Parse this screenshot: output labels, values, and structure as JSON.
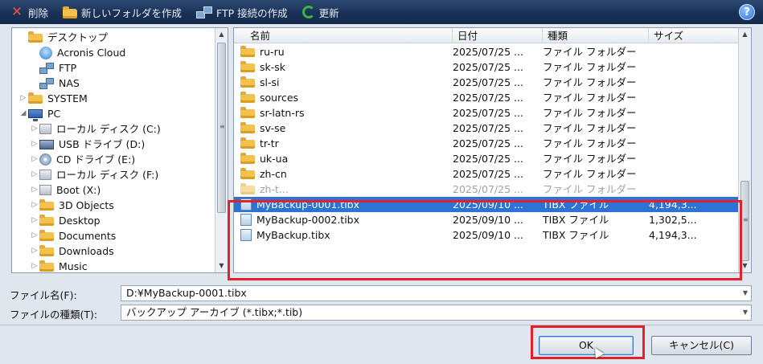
{
  "toolbar": {
    "delete_label": "削除",
    "new_folder_label": "新しいフォルダを作成",
    "ftp_label": "FTP 接続の作成",
    "refresh_label": "更新",
    "help_label": "?"
  },
  "tree": {
    "items": [
      {
        "label": "デスクトップ",
        "icon": "folder-icon",
        "expander": ""
      },
      {
        "label": "Acronis Cloud",
        "icon": "cloud-icon",
        "expander": ""
      },
      {
        "label": "FTP",
        "icon": "network-icon",
        "expander": ""
      },
      {
        "label": "NAS",
        "icon": "network-icon",
        "expander": ""
      },
      {
        "label": "SYSTEM",
        "icon": "folder-icon",
        "expander": "▷"
      },
      {
        "label": "PC",
        "icon": "computer-icon",
        "expander": "◢"
      },
      {
        "label": "ローカル ディスク (C:)",
        "icon": "disk-icon",
        "expander": "▷"
      },
      {
        "label": "USB ドライブ (D:)",
        "icon": "usb-drive-icon",
        "expander": "▷"
      },
      {
        "label": "CD ドライブ (E:)",
        "icon": "cd-drive-icon",
        "expander": "▷"
      },
      {
        "label": "ローカル ディスク (F:)",
        "icon": "disk-icon",
        "expander": "▷"
      },
      {
        "label": "Boot (X:)",
        "icon": "disk-icon",
        "expander": "▷"
      },
      {
        "label": "3D Objects",
        "icon": "folder-icon",
        "expander": "▷"
      },
      {
        "label": "Desktop",
        "icon": "folder-icon",
        "expander": "▷"
      },
      {
        "label": "Documents",
        "icon": "folder-icon",
        "expander": "▷"
      },
      {
        "label": "Downloads",
        "icon": "folder-icon",
        "expander": "▷"
      },
      {
        "label": "Music",
        "icon": "folder-icon",
        "expander": "▷"
      }
    ]
  },
  "list": {
    "columns": [
      "名前",
      "日付",
      "種類",
      "サイズ"
    ],
    "rows": [
      {
        "name": "ru-ru",
        "date": "2025/07/25 ...",
        "type": "ファイル フォルダー",
        "size": "",
        "kind": "folder"
      },
      {
        "name": "sk-sk",
        "date": "2025/07/25 ...",
        "type": "ファイル フォルダー",
        "size": "",
        "kind": "folder"
      },
      {
        "name": "sl-si",
        "date": "2025/07/25 ...",
        "type": "ファイル フォルダー",
        "size": "",
        "kind": "folder"
      },
      {
        "name": "sources",
        "date": "2025/07/25 ...",
        "type": "ファイル フォルダー",
        "size": "",
        "kind": "folder"
      },
      {
        "name": "sr-latn-rs",
        "date": "2025/07/25 ...",
        "type": "ファイル フォルダー",
        "size": "",
        "kind": "folder"
      },
      {
        "name": "sv-se",
        "date": "2025/07/25 ...",
        "type": "ファイル フォルダー",
        "size": "",
        "kind": "folder"
      },
      {
        "name": "tr-tr",
        "date": "2025/07/25 ...",
        "type": "ファイル フォルダー",
        "size": "",
        "kind": "folder"
      },
      {
        "name": "uk-ua",
        "date": "2025/07/25 ...",
        "type": "ファイル フォルダー",
        "size": "",
        "kind": "folder"
      },
      {
        "name": "zh-cn",
        "date": "2025/07/25 ...",
        "type": "ファイル フォルダー",
        "size": "",
        "kind": "folder"
      },
      {
        "name": "zh-t...",
        "date": "2025/07/25 ...",
        "type": "ファイル フォルダー",
        "size": "",
        "kind": "folder"
      },
      {
        "name": "MyBackup-0001.tibx",
        "date": "2025/09/10 ...",
        "type": "TIBX ファイル",
        "size": "4,194,3...",
        "kind": "file"
      },
      {
        "name": "MyBackup-0002.tibx",
        "date": "2025/09/10 ...",
        "type": "TIBX ファイル",
        "size": "1,302,5...",
        "kind": "file"
      },
      {
        "name": "MyBackup.tibx",
        "date": "2025/09/10 ...",
        "type": "TIBX ファイル",
        "size": "4,194,3...",
        "kind": "file"
      }
    ],
    "selected_index": 10
  },
  "fields": {
    "filename_label": "ファイル名(F):",
    "filename_value": "D:¥MyBackup-0001.tibx",
    "filetype_label": "ファイルの種類(T):",
    "filetype_value": "バックアップ アーカイブ (*.tibx;*.tib)"
  },
  "buttons": {
    "ok_label": "OK",
    "cancel_label": "キャンセル(C)"
  },
  "colors": {
    "selection": "#2d72d5",
    "highlight_box": "#e5202a",
    "toolbar": "#1a3157"
  }
}
